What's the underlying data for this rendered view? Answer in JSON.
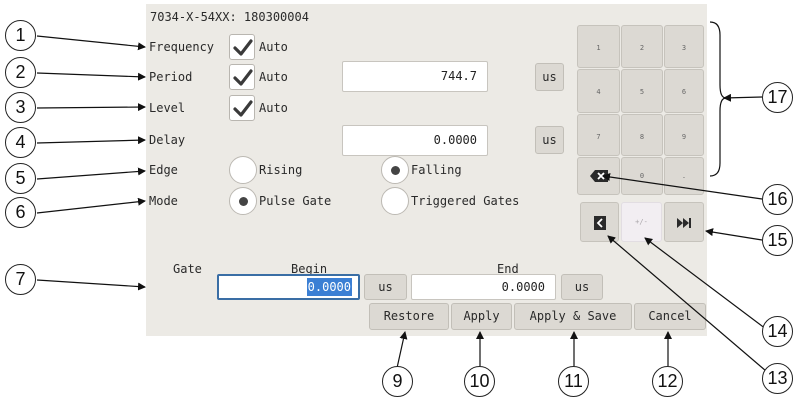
{
  "device_id": "7034-X-54XX: 180300004",
  "rows": {
    "frequency": {
      "label": "Frequency",
      "auto_label": "Auto"
    },
    "period": {
      "label": "Period",
      "auto_label": "Auto",
      "value": "744.7",
      "unit": "us"
    },
    "level": {
      "label": "Level",
      "auto_label": "Auto"
    },
    "delay": {
      "label": "Delay",
      "value": "0.0000",
      "unit": "us"
    },
    "edge": {
      "label": "Edge",
      "options": [
        "Rising",
        "Falling"
      ],
      "selected": "Falling"
    },
    "mode": {
      "label": "Mode",
      "options": [
        "Pulse Gate",
        "Triggered Gates"
      ],
      "selected": "Pulse Gate"
    }
  },
  "gate": {
    "label": "Gate",
    "begin_label": "Begin",
    "begin_value": "0.0000",
    "begin_unit": "us",
    "end_label": "End",
    "end_value": "0.0000",
    "end_unit": "us"
  },
  "actions": {
    "restore": "Restore",
    "apply": "Apply",
    "apply_save": "Apply & Save",
    "cancel": "Cancel"
  },
  "keypad": {
    "keys": [
      "1",
      "2",
      "3",
      "4",
      "5",
      "6",
      "7",
      "8",
      "9",
      "0",
      "."
    ],
    "sign": "+/-",
    "icons": [
      "backspace-icon",
      "chevron-left-icon",
      "fast-forward-icon"
    ]
  },
  "callouts": [
    "1",
    "2",
    "3",
    "4",
    "5",
    "6",
    "7",
    "9",
    "10",
    "11",
    "12",
    "13",
    "14",
    "15",
    "16",
    "17"
  ],
  "colors": {
    "panel": "#eceae5",
    "button": "#dcd9d3",
    "selection": "#3b7fd4",
    "focus_border": "#3a6ea5"
  }
}
